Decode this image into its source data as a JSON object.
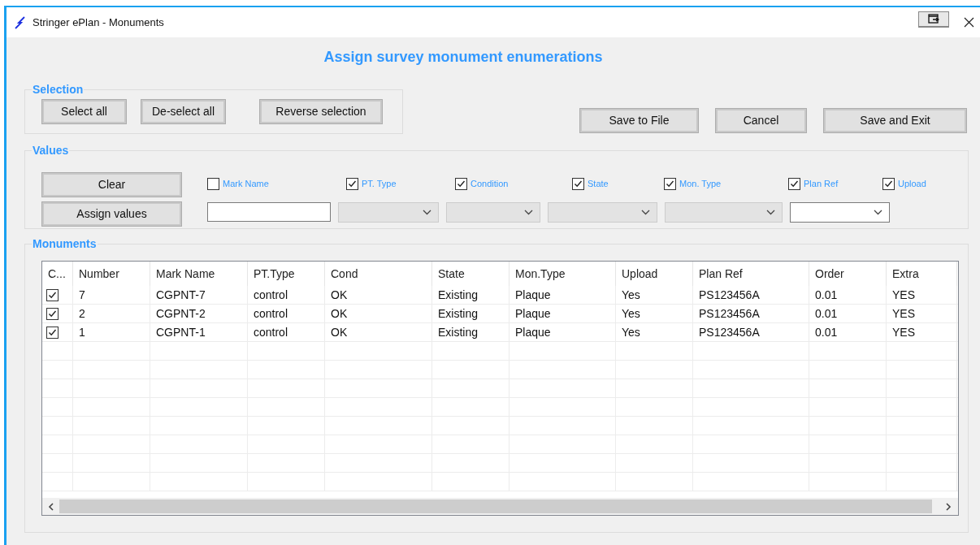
{
  "window": {
    "title": "Stringer ePlan - Monuments"
  },
  "heading": "Assign survey monument enumerations",
  "selection": {
    "title": "Selection",
    "buttons": [
      "Select all",
      "De-select all",
      "Reverse selection"
    ]
  },
  "actions": [
    "Save to File",
    "Cancel",
    "Save and Exit"
  ],
  "values": {
    "title": "Values",
    "buttons": [
      "Clear",
      "Assign values"
    ],
    "options": [
      {
        "label": "Mark Name",
        "checked": false
      },
      {
        "label": "PT. Type",
        "checked": true
      },
      {
        "label": "Condition",
        "checked": true
      },
      {
        "label": "State",
        "checked": true
      },
      {
        "label": "Mon. Type",
        "checked": true
      },
      {
        "label": "Plan Ref",
        "checked": true
      },
      {
        "label": "Upload",
        "checked": true
      }
    ],
    "fields": [
      {
        "kind": "text",
        "disabled": false
      },
      {
        "kind": "select",
        "disabled": true
      },
      {
        "kind": "select",
        "disabled": true
      },
      {
        "kind": "select",
        "disabled": true
      },
      {
        "kind": "select",
        "disabled": true
      },
      {
        "kind": "select",
        "disabled": false
      }
    ]
  },
  "monuments": {
    "title": "Monuments",
    "columns": [
      "C...",
      "Number",
      "Mark Name",
      "PT.Type",
      "Cond",
      "State",
      "Mon.Type",
      "Upload",
      "Plan Ref",
      "Order",
      "Extra"
    ],
    "rows": [
      {
        "checked": true,
        "cells": [
          "",
          "7",
          "CGPNT-7",
          "control",
          "OK",
          "Existing",
          "Plaque",
          "Yes",
          "PS123456A",
          "0.01",
          "YES"
        ]
      },
      {
        "checked": true,
        "cells": [
          "",
          "2",
          "CGPNT-2",
          "control",
          "OK",
          "Existing",
          "Plaque",
          "Yes",
          "PS123456A",
          "0.01",
          "YES"
        ]
      },
      {
        "checked": true,
        "cells": [
          "",
          "1",
          "CGPNT-1",
          "control",
          "OK",
          "Existing",
          "Plaque",
          "Yes",
          "PS123456A",
          "0.01",
          "YES"
        ]
      }
    ]
  }
}
